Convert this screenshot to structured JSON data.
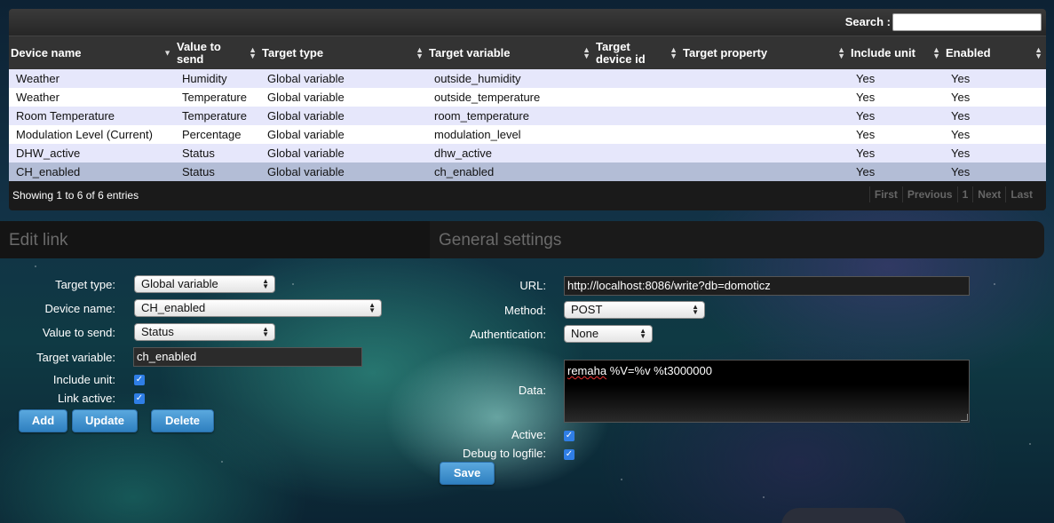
{
  "table": {
    "search_label": "Search :",
    "columns": [
      "Device name",
      "Value to send",
      "Target type",
      "Target variable",
      "Target device id",
      "Target property",
      "Include unit",
      "Enabled"
    ],
    "rows": [
      [
        "Weather",
        "Humidity",
        "Global variable",
        "outside_humidity",
        "",
        "",
        "Yes",
        "Yes"
      ],
      [
        "Weather",
        "Temperature",
        "Global variable",
        "outside_temperature",
        "",
        "",
        "Yes",
        "Yes"
      ],
      [
        "Room Temperature",
        "Temperature",
        "Global variable",
        "room_temperature",
        "",
        "",
        "Yes",
        "Yes"
      ],
      [
        "Modulation Level (Current)",
        "Percentage",
        "Global variable",
        "modulation_level",
        "",
        "",
        "Yes",
        "Yes"
      ],
      [
        "DHW_active",
        "Status",
        "Global variable",
        "dhw_active",
        "",
        "",
        "Yes",
        "Yes"
      ],
      [
        "CH_enabled",
        "Status",
        "Global variable",
        "ch_enabled",
        "",
        "",
        "Yes",
        "Yes"
      ]
    ],
    "info": "Showing 1 to 6 of 6 entries",
    "pager": [
      "First",
      "Previous",
      "1",
      "Next",
      "Last"
    ]
  },
  "edit_link": {
    "title": "Edit link",
    "target_type_label": "Target type:",
    "target_type_value": "Global variable",
    "device_name_label": "Device name:",
    "device_name_value": "CH_enabled",
    "value_to_send_label": "Value to send:",
    "value_to_send_value": "Status",
    "target_variable_label": "Target variable:",
    "target_variable_value": "ch_enabled",
    "include_unit_label": "Include unit:",
    "link_active_label": "Link active:",
    "add_label": "Add",
    "update_label": "Update",
    "delete_label": "Delete"
  },
  "general": {
    "title": "General settings",
    "url_label": "URL:",
    "url_value": "http://localhost:8086/write?db=domoticz",
    "method_label": "Method:",
    "method_value": "POST",
    "auth_label": "Authentication:",
    "auth_value": "None",
    "data_label": "Data:",
    "data_word1": "remaha",
    "data_rest": " %V=%v %t3000000",
    "active_label": "Active:",
    "debug_label": "Debug to logfile:",
    "save_label": "Save"
  },
  "icons": {
    "sort": "sort-both-icon",
    "sort_desc": "sort-desc-icon",
    "select_arrows": "updown-arrows-icon",
    "check": "checkmark-icon"
  }
}
